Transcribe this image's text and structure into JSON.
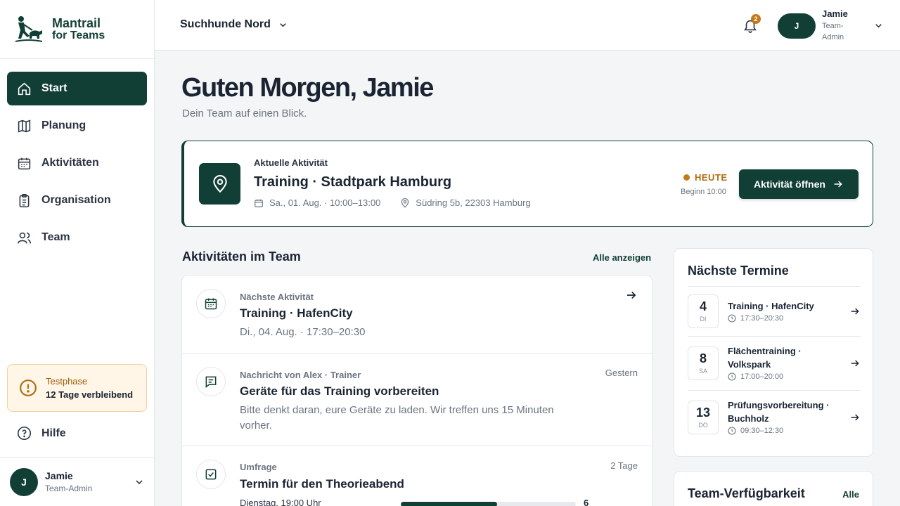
{
  "brand": {
    "name_line1": "Mantrail",
    "name_line2": "for Teams"
  },
  "colors": {
    "primary": "#123f35",
    "accent": "#c27a1c",
    "trial_bg": "#fff6e8"
  },
  "sidebar": {
    "items": [
      {
        "label": "Start",
        "icon": "home-icon",
        "active": true
      },
      {
        "label": "Planung",
        "icon": "map-icon"
      },
      {
        "label": "Aktivitäten",
        "icon": "calendar-icon"
      },
      {
        "label": "Organisation",
        "icon": "clipboard-icon"
      },
      {
        "label": "Team",
        "icon": "users-icon"
      }
    ],
    "trial": {
      "label": "Testphase",
      "remaining": "12 Tage verbleibend"
    },
    "help": "Hilfe",
    "user": {
      "initial": "J",
      "name": "Jamie",
      "role": "Team-Admin"
    }
  },
  "topbar": {
    "team": "Suchhunde Nord",
    "notifications": "2",
    "user": {
      "initial": "J",
      "name": "Jamie",
      "role": "Team-Admin"
    }
  },
  "main": {
    "greeting": "Guten Morgen, Jamie",
    "subtitle": "Dein Team auf einen Blick."
  },
  "hero": {
    "kicker": "Aktuelle Aktivität",
    "title": "Training · Stadtpark Hamburg",
    "date": "Sa., 01. Aug. · 10:00–13:00",
    "location": "Südring 5b, 22303 Hamburg",
    "status": "HEUTE",
    "begin": "Beginn 10:00",
    "button": "Aktivität öffnen"
  },
  "feed": {
    "title": "Aktivitäten im Team",
    "show_all": "Alle anzeigen",
    "items": [
      {
        "kicker": "Nächste Aktivität",
        "title": "Training · HafenCity",
        "text": "Di., 04. Aug. · 17:30–20:30",
        "time": ""
      },
      {
        "kicker": "Nachricht von Alex · Trainer",
        "title": "Geräte für das Training vorbereiten",
        "text": "Bitte denkt daran, eure Geräte zu laden. Wir treffen uns 15 Minuten vorher.",
        "time": "Gestern"
      },
      {
        "kicker": "Umfrage",
        "title": "Termin für den Theorieabend",
        "time": "2 Tage",
        "poll_option": "Dienstag, 19:00 Uhr",
        "poll_count": "6",
        "poll_fraction": 0.55
      }
    ]
  },
  "termine": {
    "title": "Nächste Termine",
    "items": [
      {
        "day": "4",
        "dow": "DI",
        "name": "Training · HafenCity",
        "time": "17:30–20:30"
      },
      {
        "day": "8",
        "dow": "SA",
        "name": "Flächentraining · Volkspark",
        "time": "17:00–20:00"
      },
      {
        "day": "13",
        "dow": "DO",
        "name": "Prüfungsvorbereitung · Buchholz",
        "time": "09:30–12:30"
      }
    ]
  },
  "availability": {
    "title": "Team-Verfügbarkeit",
    "all": "Alle"
  }
}
